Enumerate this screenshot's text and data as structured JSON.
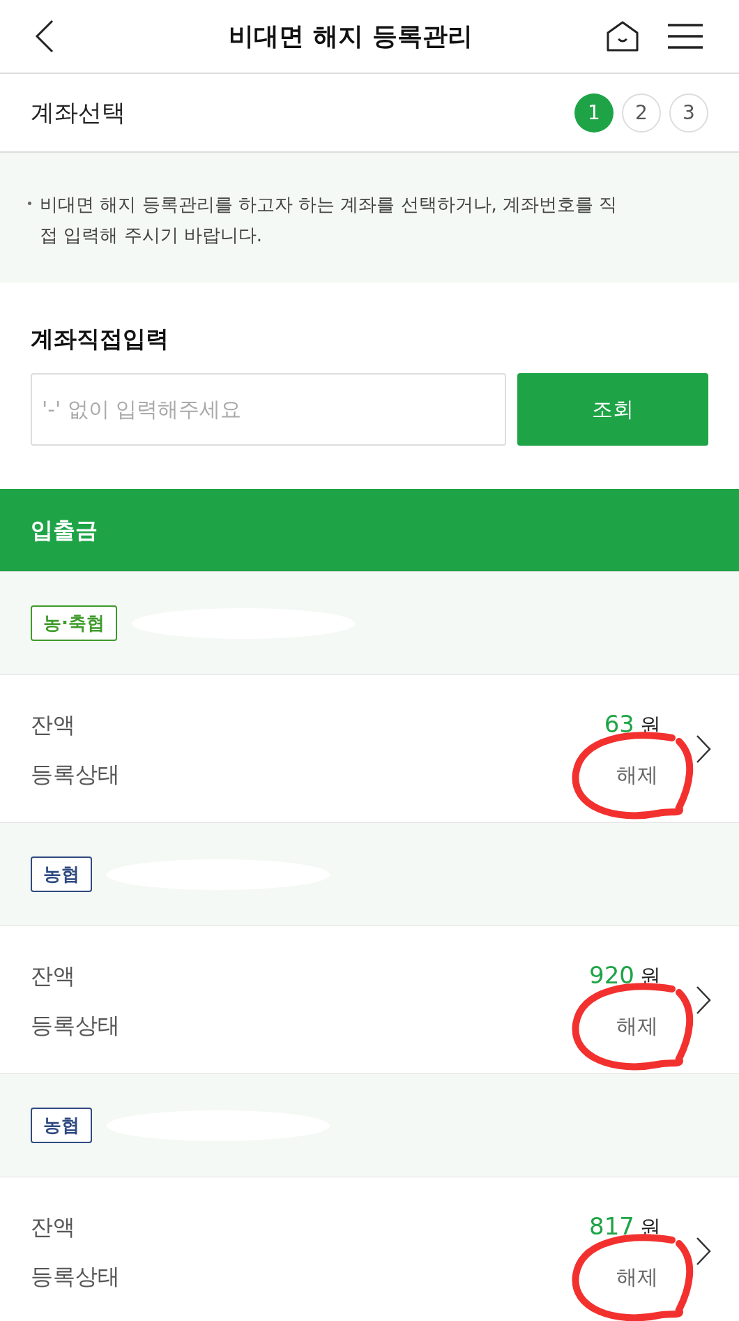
{
  "header": {
    "title": "비대면 해지 등록관리"
  },
  "step": {
    "title": "계좌선택",
    "steps": [
      {
        "label": "1",
        "selected": true
      },
      {
        "label": "2",
        "selected": false
      },
      {
        "label": "3",
        "selected": false
      }
    ]
  },
  "notice": "비대면 해지 등록관리를 하고자 하는 계좌를 선택하거나, 계좌번호를 직접 입력해 주시기 바랍니다.",
  "direct_input": {
    "title": "계좌직접입력",
    "placeholder": "'-' 없이 입력해주세요",
    "button": "조회"
  },
  "section": {
    "title": "입출금"
  },
  "accounts": [
    {
      "bank": "농·축협",
      "color": "#3f9b2a",
      "balance_label": "잔액",
      "balance": "63",
      "unit": "원",
      "status_label": "등록상태",
      "status": "해제"
    },
    {
      "bank": "농협",
      "color": "#2f4a80",
      "balance_label": "잔액",
      "balance": "920",
      "unit": "원",
      "status_label": "등록상태",
      "status": "해제"
    },
    {
      "bank": "농협",
      "color": "#2f4a80",
      "balance_label": "잔액",
      "balance": "817",
      "unit": "원",
      "status_label": "등록상태",
      "status": "해제"
    }
  ]
}
